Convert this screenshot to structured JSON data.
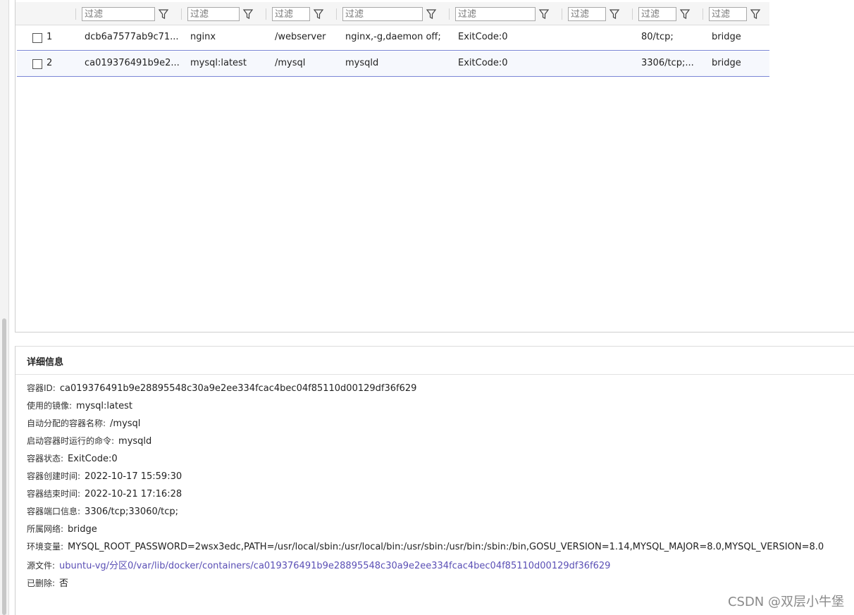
{
  "filter_bar": {
    "placeholder": "过滤",
    "columns": [
      {
        "placeholder": "过滤"
      },
      {
        "placeholder": "过滤"
      },
      {
        "placeholder": "过滤"
      },
      {
        "placeholder": "过滤"
      },
      {
        "placeholder": "过滤"
      },
      {
        "placeholder": "过滤"
      },
      {
        "placeholder": "过滤"
      },
      {
        "placeholder": "过滤"
      }
    ]
  },
  "table": {
    "rows": [
      {
        "index": "1",
        "id": "dcb6a7577ab9c71...",
        "image": "nginx",
        "name": "/webserver",
        "command": "nginx,-g,daemon off;",
        "status": "ExitCode:0",
        "col6": "",
        "ports": "80/tcp;",
        "network": "bridge"
      },
      {
        "index": "2",
        "id": "ca019376491b9e2...",
        "image": "mysql:latest",
        "name": "/mysql",
        "command": "mysqld",
        "status": "ExitCode:0",
        "col6": "",
        "ports": "3306/tcp;...",
        "network": "bridge"
      }
    ]
  },
  "details": {
    "title": "详细信息",
    "fields": [
      {
        "label": "容器ID:",
        "value": "ca019376491b9e28895548c30a9e2ee334fcac4bec04f85110d00129df36f629"
      },
      {
        "label": "使用的镜像:",
        "value": "mysql:latest"
      },
      {
        "label": "自动分配的容器名称:",
        "value": "/mysql"
      },
      {
        "label": "启动容器时运行的命令:",
        "value": "mysqld"
      },
      {
        "label": "容器状态:",
        "value": "ExitCode:0"
      },
      {
        "label": "容器创建时间:",
        "value": "2022-10-17 15:59:30"
      },
      {
        "label": "容器结束时间:",
        "value": "2022-10-21 17:16:28"
      },
      {
        "label": "容器端口信息:",
        "value": "3306/tcp;33060/tcp;"
      },
      {
        "label": "所属网络:",
        "value": "bridge"
      },
      {
        "label": "环境变量:",
        "value": "MYSQL_ROOT_PASSWORD=2wsx3edc,PATH=/usr/local/sbin:/usr/local/bin:/usr/sbin:/usr/bin:/sbin:/bin,GOSU_VERSION=1.14,MYSQL_MAJOR=8.0,MYSQL_VERSION=8.0"
      },
      {
        "label": "源文件:",
        "value": "ubuntu-vg/分区0/var/lib/docker/containers/ca019376491b9e28895548c30a9e2ee334fcac4bec04f85110d00129df36f629"
      },
      {
        "label": "已删除:",
        "value": "否"
      }
    ]
  },
  "watermark": "CSDN @双层小牛堡",
  "colors": {
    "row_border": "#7b86d6",
    "link": "#5a4fb5"
  }
}
